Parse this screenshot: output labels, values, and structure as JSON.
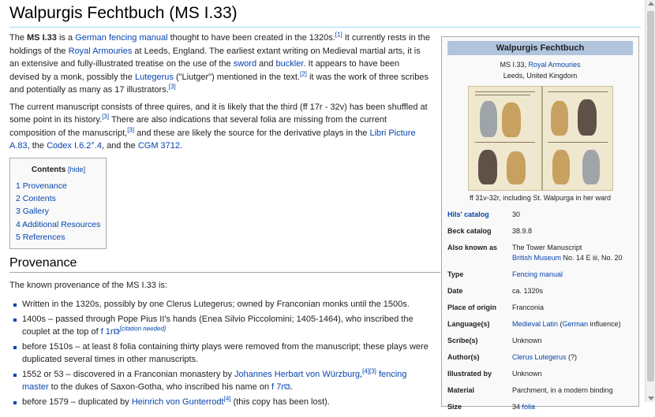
{
  "title": "Walpurgis Fechtbuch (MS I.33)",
  "intro": {
    "p1": {
      "t1": "The ",
      "b1": "MS I.33",
      "t2": " is a ",
      "l1": "German fencing manual",
      "t3": " thought to have been created in the 1320s.",
      "r1": "[1]",
      "t4": " It currently rests in the holdings of the ",
      "l2": "Royal Armouries",
      "t5": " at Leeds, England. The earliest extant writing on Medieval martial arts, it is an extensive and fully-illustrated treatise on the use of the ",
      "l3": "sword",
      "t6": " and ",
      "l4": "buckler",
      "t7": ". It appears to have been devised by a monk, possibly the ",
      "l5": "Lutegerus",
      "t8": " (\"Liutger\") mentioned in the text.",
      "r2": "[2]",
      "t9": " it was the work of three scribes and potentially as many as 17 illustrators.",
      "r3": "[3]"
    },
    "p2": {
      "t1": "The current manuscript consists of three quires, and it is likely that the third (ff 17r - 32v) has been shuffled at some point in its history.",
      "r1": "[3]",
      "t2": " There are also indications that several folia are missing from the current composition of the manuscript,",
      "r2": "[3]",
      "t3": " and these are likely the source for the derivative plays in the ",
      "l1": "Libri Picture A.83",
      "t4": ", the ",
      "l2": "Codex I.6.2°.4",
      "t5": ", and the ",
      "l3": "CGM 3712",
      "t6": "."
    }
  },
  "toc": {
    "heading": "Contents",
    "hide": "[hide]",
    "items": [
      "1 Provenance",
      "2 Contents",
      "3 Gallery",
      "4 Additional Resources",
      "5 References"
    ]
  },
  "provenance": {
    "heading": "Provenance",
    "lead": "The known provenance of the MS I.33 is:",
    "b1": "Written in the 1320s, possibly by one Clerus Lutegerus; owned by Franconian monks until the 1500s.",
    "b2": {
      "t1": "1400s – passed through Pope Pius II's hands (Enea Silvio Piccolomini; 1405-1464), who inscribed the couplet at the top of ",
      "l1": "f 1r",
      "ext": "⧉",
      "r1": "[citation needed]"
    },
    "b3": "before 1510s – at least 8 folia containing thirty plays were removed from the manuscript; these plays were duplicated several times in other manuscripts.",
    "b4": {
      "t1": "1552 or 53 – discovered in a Franconian monastery by ",
      "l1": "Johannes Herbart von Würzburg",
      "t2": ",",
      "r1": "[4][3]",
      "t3": " ",
      "l2": "fencing master",
      "t4": " to the dukes of Saxon-Gotha, who inscribed his name on ",
      "l3": "f 7r",
      "ext": "⧉",
      "t5": "."
    },
    "b5": {
      "t1": "before 1579 – duplicated by ",
      "l1": "Heinrich von Gunterrodt",
      "r1": "[4]",
      "t2": " (this copy has been lost)."
    }
  },
  "infobox": {
    "title": "Walpurgis Fechtbuch",
    "sub1_t": "MS I.33, ",
    "sub1_l": "Royal Armouries",
    "sub2": "Leeds, United Kingdom",
    "caption": "ff 31v-32r, including St. Walpurga in her ward",
    "rows": [
      {
        "label": "Hils' catalog",
        "label_link": true,
        "value": "30"
      },
      {
        "label": "Beck catalog",
        "value": "38.9.8"
      },
      {
        "label": "Also known as",
        "value": "The Tower Manuscript",
        "value2_l": "British Museum",
        "value2_t": " No. 14 E iii, No. 20"
      },
      {
        "label": "Type",
        "value_l": "Fencing manual"
      },
      {
        "label": "Date",
        "value": "ca. 1320s"
      },
      {
        "label": "Place of origin",
        "value": "Franconia"
      },
      {
        "label": "Language(s)",
        "value_l": "Medieval Latin",
        "value_t": " (",
        "value_l2": "German",
        "value_t2": " influence)"
      },
      {
        "label": "Scribe(s)",
        "value": "Unknown"
      },
      {
        "label": "Author(s)",
        "value_l": "Clerus Lutegerus",
        "value_t": " (?)"
      },
      {
        "label": "Illustrated by",
        "value": "Unknown"
      },
      {
        "label": "Material",
        "value": "Parchment, in a modern binding"
      },
      {
        "label": "Size",
        "value": "34 ",
        "value_l": "folia"
      }
    ]
  },
  "colors": {
    "link": "#0645ad",
    "infobox_header": "#b0c4de",
    "infobox_bg": "#f9f9f9",
    "title_rule": "#a7d7f9"
  }
}
